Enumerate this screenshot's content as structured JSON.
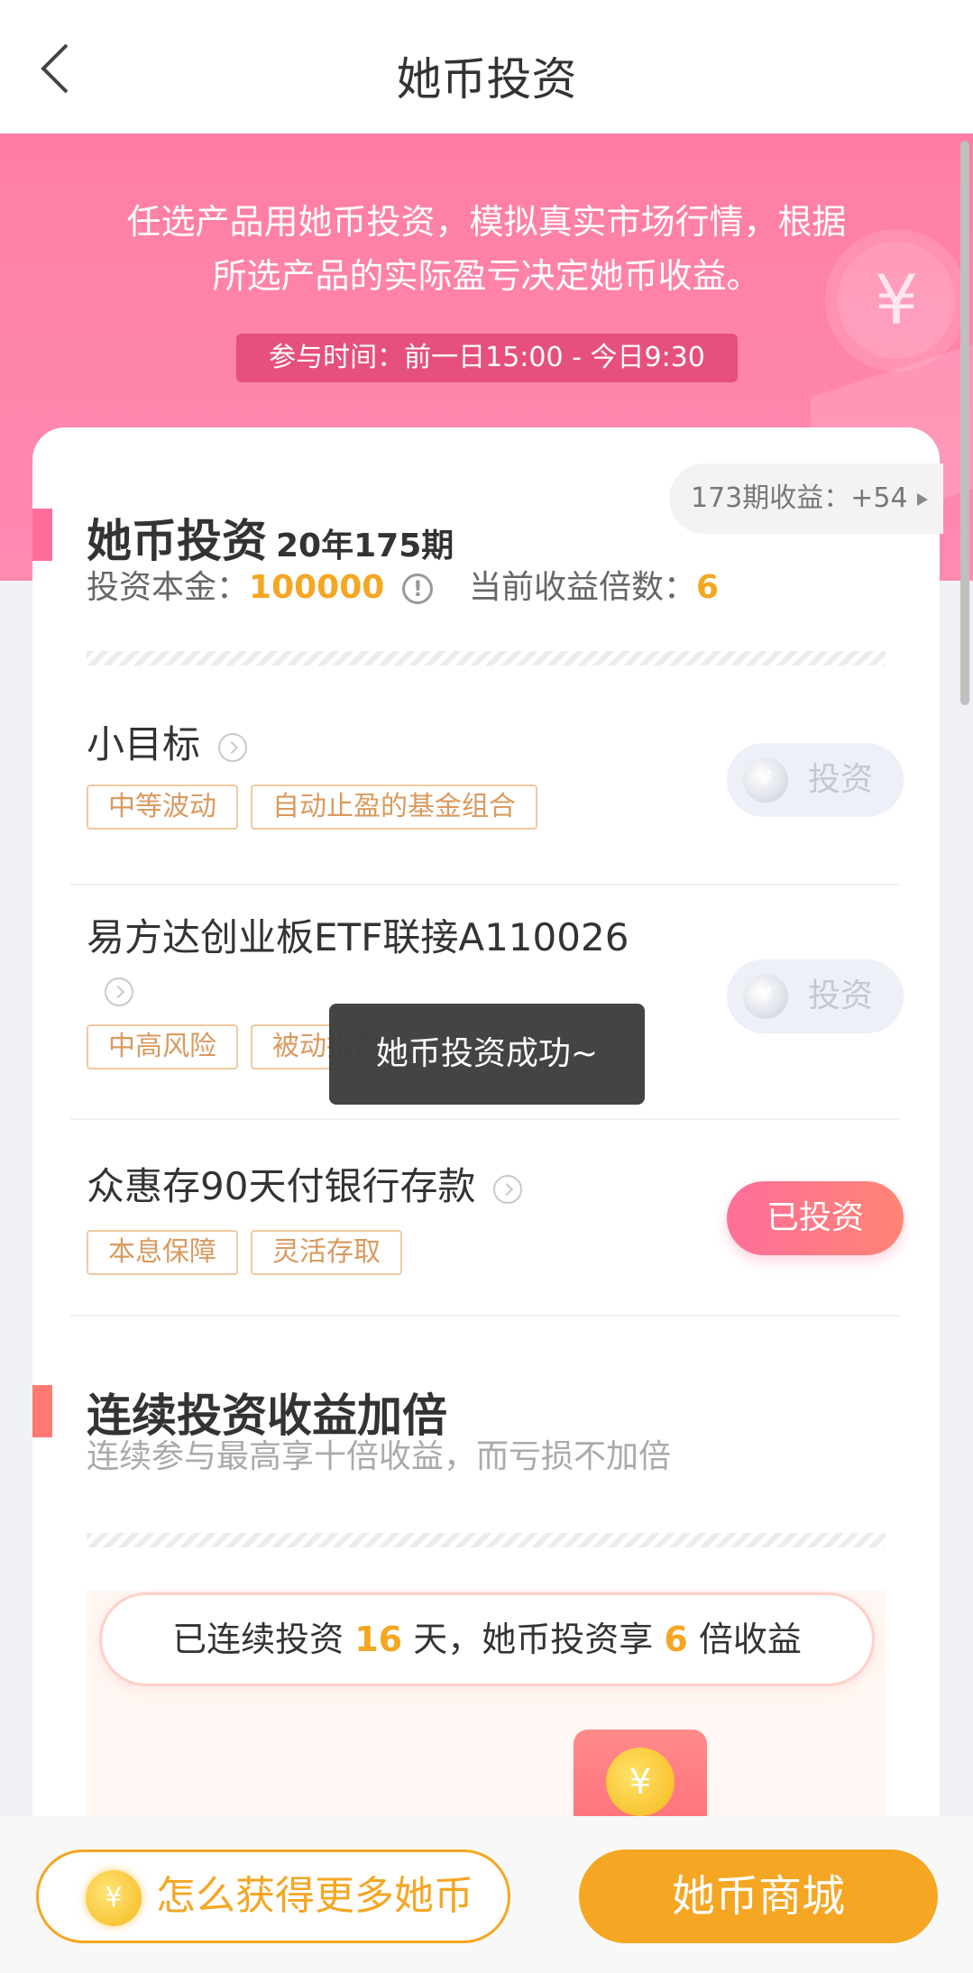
{
  "header": {
    "title": "她币投资",
    "back_icon": "chevron-left-icon"
  },
  "banner": {
    "description_line1": "任选产品用她币投资，模拟真实市场行情，根据",
    "description_line2": "所选产品的实际盈亏决定她币收益。",
    "time": "参与时间：前一日15:00 - 今日9:30",
    "coin_symbol": "¥"
  },
  "section1": {
    "title": "她币投资",
    "period": "20年175期",
    "earnings_link": "173期收益：+54",
    "principal_label": "投资本金：",
    "principal_value": "100000",
    "multiplier_label": "当前收益倍数：",
    "multiplier_value": "6",
    "info_icon_glyph": "!"
  },
  "products": [
    {
      "name": "小目标",
      "tags": [
        "中等波动",
        "自动止盈的基金组合"
      ],
      "button": "投资",
      "status": "available"
    },
    {
      "name": "易方达创业板ETF联接A110026",
      "tags": [
        "中高风险",
        "被动指数"
      ],
      "button": "投资",
      "status": "available"
    },
    {
      "name": "众惠存90天付银行存款",
      "tags": [
        "本息保障",
        "灵活存取"
      ],
      "button": "已投资",
      "status": "invested"
    }
  ],
  "coin_glyph": "¥",
  "section2": {
    "title": "连续投资收益加倍",
    "subtitle": "连续参与最高享十倍收益，而亏损不加倍",
    "streak_prefix": "已连续投资",
    "streak_days": "16",
    "streak_middle": "天，她币投资享",
    "streak_multiplier": "6",
    "streak_suffix": "倍收益"
  },
  "toast": "她币投资成功~",
  "bottom": {
    "more_coins": "怎么获得更多她币",
    "shop": "她币商城"
  },
  "colors": {
    "brand_pink": "#ff7ea4",
    "accent_orange": "#f5a623",
    "tag_border": "#f0c9a0"
  }
}
